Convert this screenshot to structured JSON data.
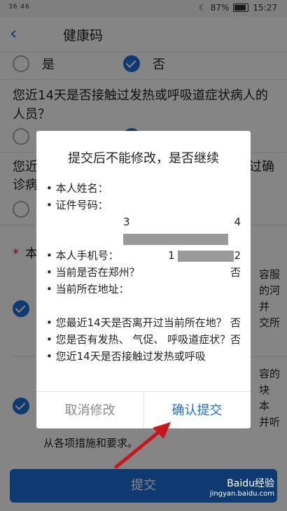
{
  "status": {
    "signal": "36 46",
    "battery": "87%",
    "time": "15:27"
  },
  "appbar": {
    "title": "健康码"
  },
  "options": {
    "yes": "是",
    "no": "否"
  },
  "questions": {
    "q1": "您近14天是否接触过发热或呼吸道症状病人的人员？",
    "q2_partial_a": "您近",
    "q2_partial_b": "过确",
    "q2_partial_c": "诊病",
    "note_star": "*",
    "note_partial": "本",
    "right_frag": [
      "容服",
      "的河",
      "并",
      "交所",
      "容的",
      "块",
      "本",
      "并听"
    ],
    "footer_line": "从各项措施和要求。"
  },
  "dialog": {
    "title": "提交后不能修改，是否继续",
    "rows": [
      {
        "label": "• 本人姓名：",
        "value": ""
      },
      {
        "label": "• 证件号码：",
        "value": ""
      },
      {
        "label": "• 本人手机号：",
        "value": ""
      },
      {
        "label": "• 当前是否在郑州？",
        "value": "否"
      },
      {
        "label": "• 当前所在地址：",
        "value": ""
      },
      {
        "label": "• 您最近14天是否离开过当前所在地？",
        "value": "否"
      },
      {
        "label": "• 您是否有发热、 气促、 呼吸道症状？",
        "value": "否"
      },
      {
        "label": "• 您近14天是否接触过发热或呼吸",
        "value": ""
      }
    ],
    "id_prefix": "3",
    "id_suffix": "4",
    "phone_prefix": "1",
    "phone_suffix": "2",
    "cancel_label": "取消修改",
    "confirm_label": "确认提交"
  },
  "submit_label": "提交",
  "watermark": {
    "brand": "Baidu经验",
    "url": "jingyan.baidu.com"
  },
  "colors": {
    "accent": "#1e6fd9",
    "arrow": "#c8161d"
  }
}
